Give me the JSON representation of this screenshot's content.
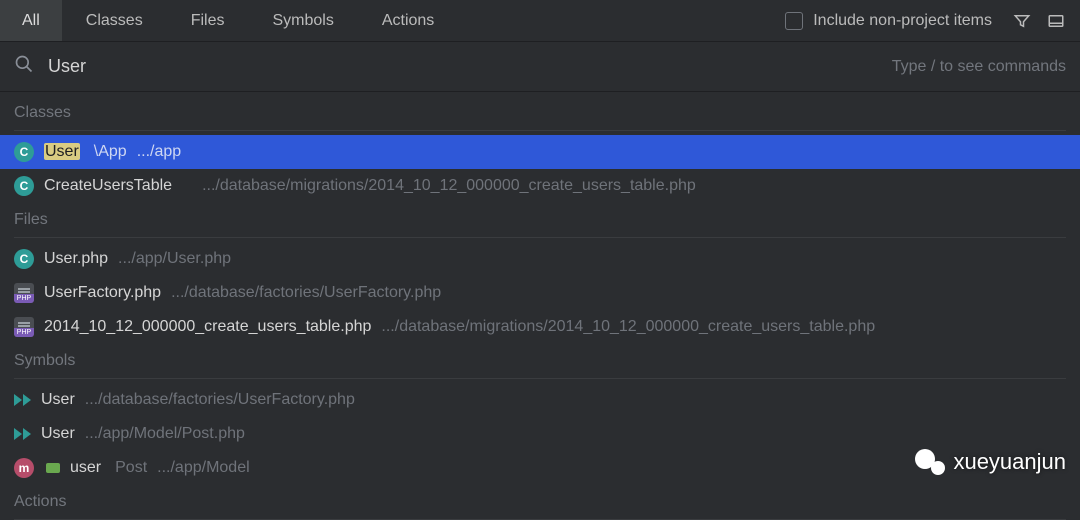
{
  "tabs": {
    "items": [
      "All",
      "Classes",
      "Files",
      "Symbols",
      "Actions"
    ],
    "active_index": 0
  },
  "toolbar": {
    "include_label": "Include non-project items",
    "include_checked": false,
    "filter_icon": "filter-icon",
    "panel_icon": "panel-icon"
  },
  "search": {
    "value": "User",
    "hint": "Type / to see commands",
    "icon": "search-icon"
  },
  "sections": [
    {
      "title": "Classes",
      "rows": [
        {
          "icon": "class-c",
          "name": "User",
          "highlight": "User",
          "context": "\\App",
          "path": ".../app",
          "selected": true
        },
        {
          "icon": "class-c",
          "name": "CreateUsersTable",
          "highlight": "",
          "context": "",
          "path": ".../database/migrations/2014_10_12_000000_create_users_table.php",
          "selected": false
        }
      ]
    },
    {
      "title": "Files",
      "rows": [
        {
          "icon": "class-c",
          "name": "User.php",
          "path": ".../app/User.php"
        },
        {
          "icon": "php-file",
          "name": "UserFactory.php",
          "path": ".../database/factories/UserFactory.php"
        },
        {
          "icon": "php-file",
          "name": "2014_10_12_000000_create_users_table.php",
          "path": ".../database/migrations/2014_10_12_000000_create_users_table.php"
        }
      ]
    },
    {
      "title": "Symbols",
      "rows": [
        {
          "icon": "dbl-tri",
          "name": "User",
          "path": ".../database/factories/UserFactory.php"
        },
        {
          "icon": "dbl-tri",
          "name": "User",
          "path": ".../app/Model/Post.php"
        },
        {
          "icon": "method-m",
          "extra_icon": "folder-mini",
          "name": "user",
          "context": "Post",
          "path": ".../app/Model"
        }
      ]
    },
    {
      "title": "Actions",
      "rows": []
    }
  ],
  "watermark": {
    "text": "xueyuanjun"
  },
  "colors": {
    "bg": "#2b2d30",
    "selected": "#2f58d8",
    "muted": "#6f737a",
    "highlight": "#d9cc82"
  }
}
